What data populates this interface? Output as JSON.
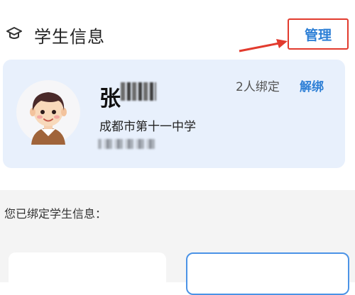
{
  "header": {
    "title": "学生信息",
    "icon": "graduation-cap-icon",
    "manage_label": "管理"
  },
  "student_card": {
    "name": "张",
    "school": "成都市第十一中学",
    "bound_count": "2人绑定",
    "unbind_label": "解绑"
  },
  "bound_section": {
    "label": "您已绑定学生信息："
  },
  "colors": {
    "accent": "#2d7fd6",
    "highlight": "#e23b2e",
    "card_bg": "#e8f0fc"
  }
}
